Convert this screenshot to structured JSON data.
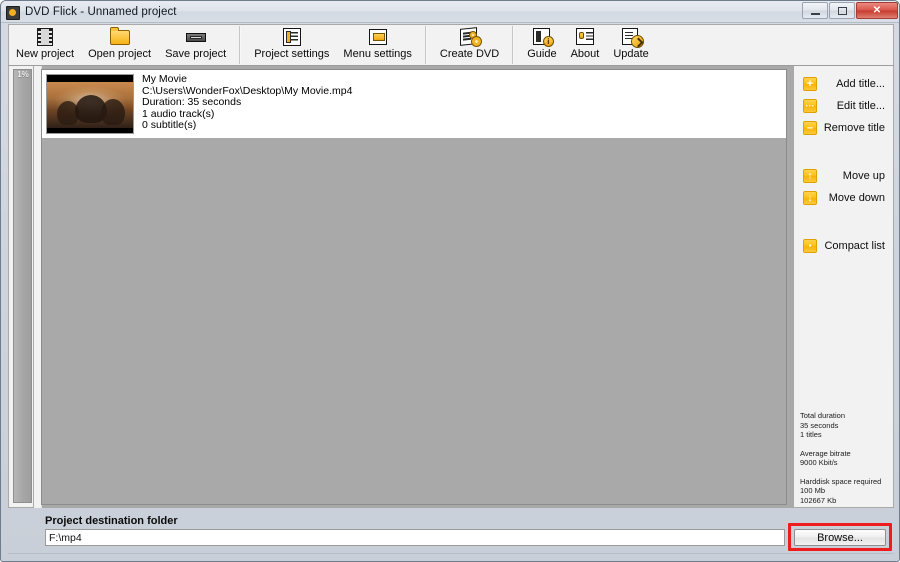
{
  "window": {
    "title": "DVD Flick - Unnamed project",
    "app_icon": "dvd-disc-icon",
    "controls": {
      "minimize": "minimize-icon",
      "maximize": "maximize-icon",
      "close": "✕"
    }
  },
  "toolbar": {
    "items": [
      {
        "label": "New project",
        "icon": "film-strip-icon"
      },
      {
        "label": "Open project",
        "icon": "folder-open-icon"
      },
      {
        "label": "Save project",
        "icon": "floppy-save-icon"
      },
      {
        "label": "Project settings",
        "icon": "project-settings-icon"
      },
      {
        "label": "Menu settings",
        "icon": "menu-settings-icon"
      },
      {
        "label": "Create DVD",
        "icon": "create-dvd-icon"
      },
      {
        "label": "Guide",
        "icon": "guide-info-icon"
      },
      {
        "label": "About",
        "icon": "about-icon"
      },
      {
        "label": "Update",
        "icon": "update-icon"
      }
    ]
  },
  "progress": {
    "percent_label": "1%"
  },
  "title_list": {
    "items": [
      {
        "name": "My Movie",
        "path": "C:\\Users\\WonderFox\\Desktop\\My Movie.mp4",
        "duration": "Duration: 35 seconds",
        "audio": "1 audio track(s)",
        "subtitles": "0 subtitle(s)"
      }
    ]
  },
  "side_panel": {
    "buttons": [
      {
        "label": "Add title...",
        "icon": "plus-icon",
        "glyph": "+"
      },
      {
        "label": "Edit title...",
        "icon": "ellipsis-icon",
        "glyph": "···"
      },
      {
        "label": "Remove title",
        "icon": "minus-icon",
        "glyph": "–"
      },
      {
        "label": "Move up",
        "icon": "arrow-up-icon",
        "glyph": "↑"
      },
      {
        "label": "Move down",
        "icon": "arrow-down-icon",
        "glyph": "↓"
      },
      {
        "label": "Compact list",
        "icon": "compact-list-icon",
        "glyph": "▪"
      }
    ]
  },
  "stats": {
    "total_duration_label": "Total duration",
    "total_duration_value": "35 seconds",
    "titles_count": "1 titles",
    "average_bitrate_label": "Average bitrate",
    "average_bitrate_value": "9000 Kbit/s",
    "harddisk_label": "Harddisk space required",
    "harddisk_mb": "100 Mb",
    "harddisk_kb": "102667 Kb"
  },
  "destination": {
    "label": "Project destination folder",
    "value": "F:\\mp4",
    "browse_label": "Browse..."
  },
  "colors": {
    "accent_yellow": "#fcc016",
    "highlight_red": "#ee1c1c",
    "list_background": "#a9a9a9",
    "panel_background": "#f2f2f2"
  }
}
